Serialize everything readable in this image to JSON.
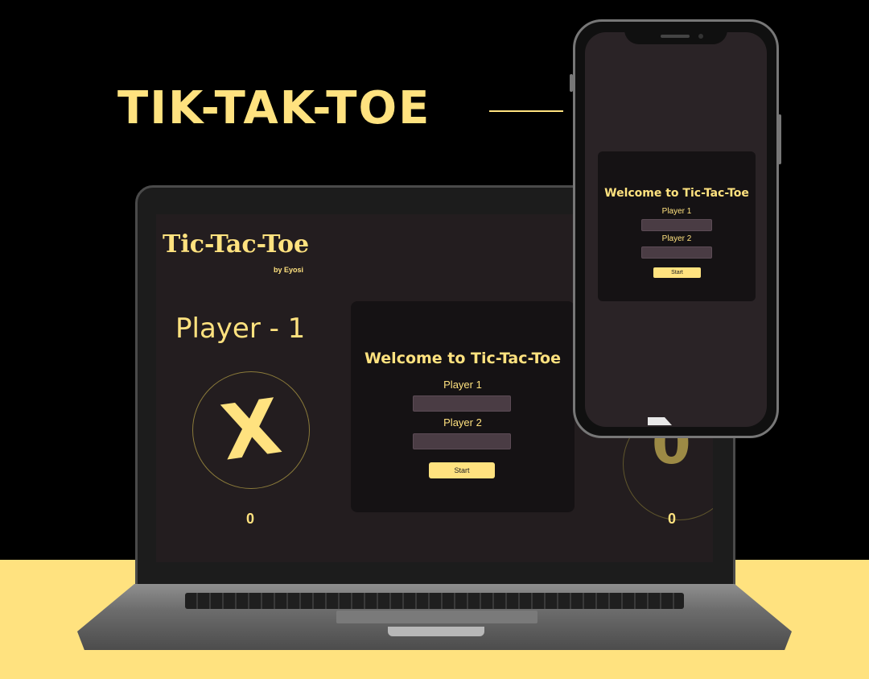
{
  "headline": "TIK-TAK-TOE",
  "laptop_app": {
    "title": "Tic-Tac-Toe",
    "byline": "by Eyosi",
    "current_player": "Player - 1",
    "player1_mark": "X",
    "player2_mark": "0",
    "player1_score": "0",
    "player2_score": "0",
    "welcome": {
      "title": "Welcome to Tic-Tac-Toe",
      "player1_label": "Player 1",
      "player1_value": "",
      "player2_label": "Player 2",
      "player2_value": "",
      "start_label": "Start"
    }
  },
  "phone_app": {
    "welcome": {
      "title": "Welcome to Tic-Tac-Toe",
      "player1_label": "Player 1",
      "player1_value": "",
      "player2_label": "Player 2",
      "player2_value": "",
      "start_label": "Start"
    }
  },
  "colors": {
    "accent": "#ffe27f",
    "background": "#000000",
    "screen_bg": "#231d1f",
    "card_bg": "#151214",
    "input_bg": "#4a3c44"
  }
}
